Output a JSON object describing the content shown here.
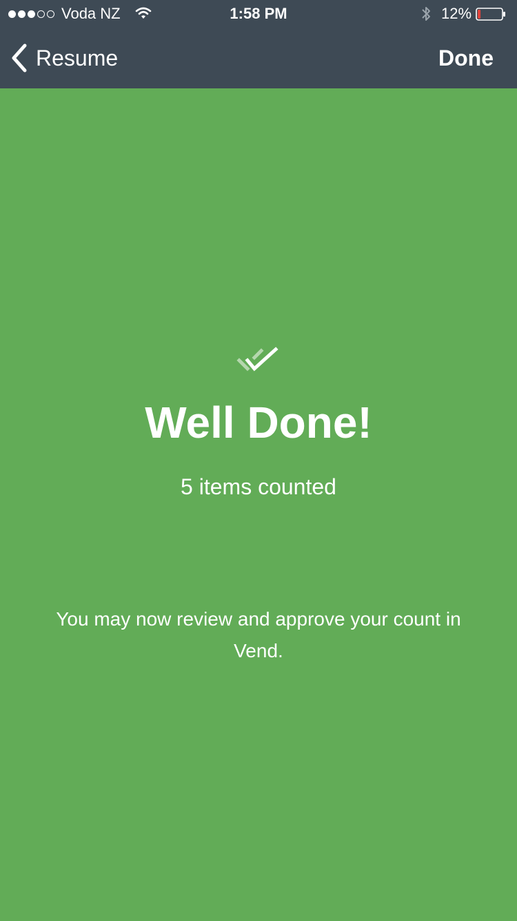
{
  "status_bar": {
    "signal_full": 3,
    "signal_empty": 2,
    "carrier": "Voda NZ",
    "time": "1:58 PM",
    "battery_percent": "12%",
    "battery_level": 0.12,
    "battery_color": "#e0443c",
    "icons": [
      "signal-dots",
      "wifi-icon",
      "bluetooth-icon",
      "battery-icon"
    ]
  },
  "nav": {
    "back_label": "Resume",
    "back_icon": "chevron-left-icon",
    "done_label": "Done",
    "bar_color": "#3e4a55"
  },
  "main": {
    "icon": "double-check-icon",
    "headline": "Well Done!",
    "subline": "5 items counted",
    "message": "You may now review and approve your count in Vend.",
    "background_color": "#62ac57"
  }
}
